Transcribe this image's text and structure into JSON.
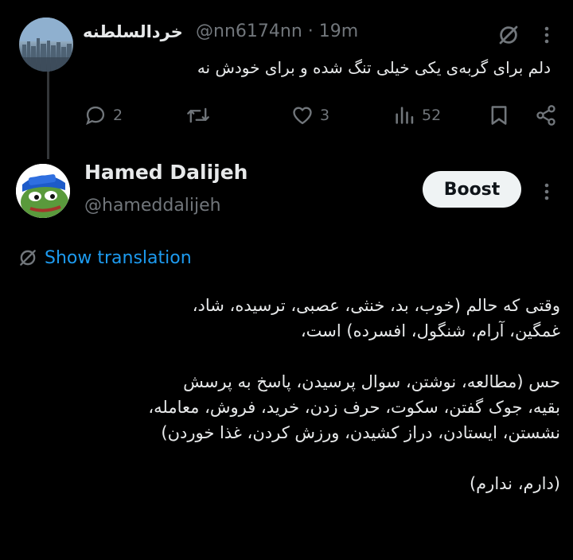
{
  "reply_tweet": {
    "display_name": "خردالسلطنه",
    "handle": "@nn6174nn",
    "separator": "·",
    "time": "19m",
    "text": "دلم برای گربه‌ی یکی خیلی تنگ شده و برای خودش نه",
    "actions": {
      "reply_count": "2",
      "repost_count": "",
      "like_count": "3",
      "view_count": "52"
    },
    "icons": [
      "translate-icon",
      "more-icon",
      "reply-icon",
      "repost-icon",
      "like-icon",
      "views-icon",
      "bookmark-icon",
      "share-icon"
    ]
  },
  "main_tweet": {
    "display_name": "Hamed Dalijeh",
    "handle": "@hameddalijeh",
    "boost_label": "Boost",
    "show_translation_label": "Show translation",
    "paragraphs": [
      [
        "وقتی که حالم (خوب، بد، خنثی، عصبی، ترسیده، شاد،",
        "غمگین، آرام، شنگول، افسرده) است،"
      ],
      [
        "حس (مطالعه، نوشتن، سوال پرسیدن، پاسخ به پرسش",
        "بقیه، جوک گفتن، سکوت، حرف زدن، خرید، فروش، معامله،",
        "نشستن، ایستادن، دراز کشیدن، ورزش کردن، غذا خوردن)"
      ],
      [
        "(دارم، ندارم)"
      ]
    ]
  },
  "colors": {
    "background": "#000000",
    "text": "#e7e9ea",
    "muted": "#71767b",
    "link": "#1d9bf0",
    "button_bg": "#eff3f4",
    "thread_line": "#333639"
  }
}
